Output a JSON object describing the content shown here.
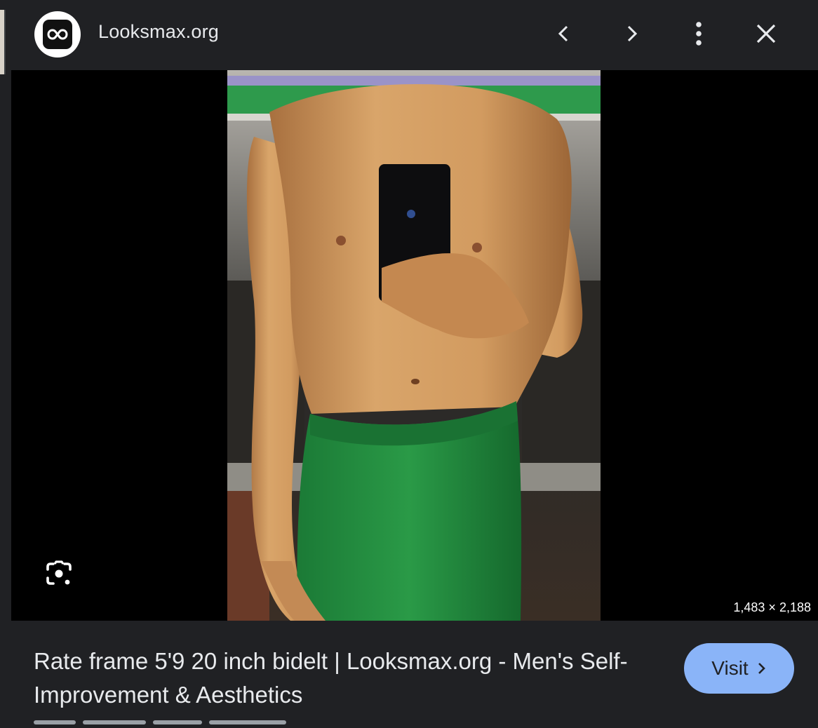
{
  "header": {
    "site_name": "Looksmax.org",
    "icons": {
      "logo": "infinity-logo-icon",
      "prev": "chevron-left-icon",
      "next": "chevron-right-icon",
      "more": "more-vert-icon",
      "close": "close-icon"
    }
  },
  "viewer": {
    "dimensions": "1,483 × 2,188",
    "lens_icon": "google-lens-icon"
  },
  "footer": {
    "title": "Rate frame 5'9 20 inch bidelt | Looksmax.org - Men's Self-Improvement & Aesthetics",
    "visit_label": "Visit"
  },
  "colors": {
    "background": "#202124",
    "viewer_background": "#000000",
    "visit_button": "#8ab4f8",
    "text": "#e8eaed"
  }
}
